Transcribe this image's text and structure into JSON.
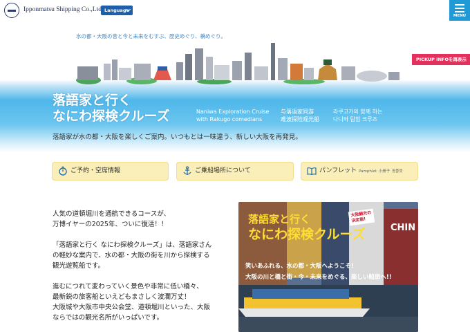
{
  "header": {
    "company": "Ipponmatsu Shipping Co.,Ltd",
    "language_label": "Language",
    "menu_label": "MENU"
  },
  "hero": {
    "tagline": "水の都・大阪の昔と今と未来をむすぶ、歴史めぐり、橋めぐり。",
    "pickup_label": "PICKUP INFOを再表示",
    "title_line1": "落語家と行く",
    "title_line2": "なにわ探検クルーズ",
    "sub_en_line1": "Naniwa Exploration Cruise",
    "sub_en_line2": "with Rakugo comedians",
    "sub_zh_line1": "与落语家同游",
    "sub_zh_line2": "难波探险观光船",
    "sub_ko_line1": "라쿠고가와 함께 하는",
    "sub_ko_line2": "나니와 탐험 크루즈",
    "intro": "落語家が水の都・大阪を楽しくご案内。いつもとは一味違う、新しい大阪を再発見。"
  },
  "nav": {
    "reservation": "ご予約・空席情報",
    "boarding": "ご乗船場所について",
    "pamphlet": "パンフレット",
    "pamphlet_en": "Pamphlet",
    "pamphlet_zh": "小册子",
    "pamphlet_ko": "팜플렛"
  },
  "body": {
    "p1_line1": "人気の道頓堀川を通航できるコースが、",
    "p1_line2": "万博イヤーの2025年、ついに復活！！",
    "p2_line1": "「落語家と行く なにわ探検クルーズ」は、落語家さん",
    "p2_line2": "の軽妙な案内で、水の都・大阪の街を川から探検する",
    "p2_line3": "観光遊覧船です。",
    "p3_line1": "進むにつれて変わっていく景色や非常に低い橋々、",
    "p3_line2": "最新鋭の旅客船といえどもまさしく波瀾万丈！",
    "p3_line3": "大阪城や大阪市中央公会堂、道頓堀川といった、大阪",
    "p3_line4": "ならではの観光名所がいっぱいです。"
  },
  "photo": {
    "title_line1": "落語家と行く",
    "title_line2": "なにわ探検クルーズ",
    "badge_line1": "大阪観光の",
    "badge_line2": "決定版!",
    "caption_line1": "笑いあふれる、水の都・大阪へようこそ!",
    "caption_line2": "大阪の川と橋と街・今・未来をめぐる、楽しい船旅へ!!",
    "sign_text": "CHIN"
  },
  "colors": {
    "accent_blue": "#1f9ad6",
    "pickup_red": "#e4305c",
    "nav_yellow": "#fbefb9"
  }
}
